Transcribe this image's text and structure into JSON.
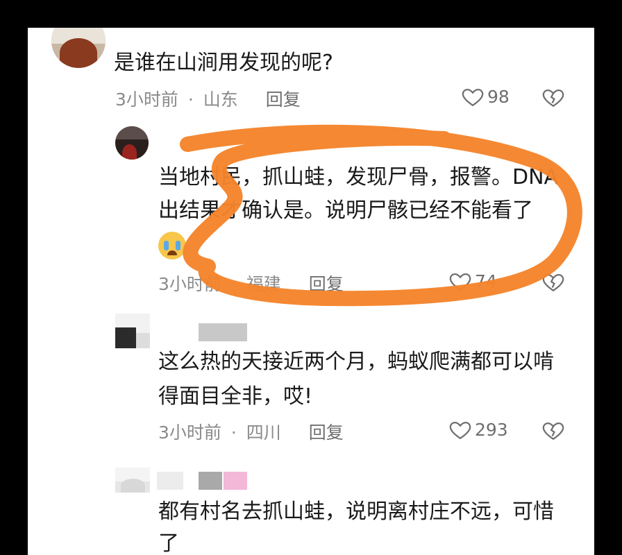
{
  "comments": [
    {
      "text_lines": [
        "是谁在山涧用发现的呢?"
      ],
      "time": "3小时前",
      "location": "山东",
      "separator": "·",
      "reply_label": "回复",
      "likes": "98"
    },
    {
      "text_lines": [
        "当地村民，抓山蛙，发现尸骨，报警。DNA",
        "出结果才确认是。说明尸骸已经不能看了"
      ],
      "emoji": "crying-face",
      "time": "3小时前",
      "location": "福建",
      "separator": "·",
      "reply_label": "回复",
      "likes": "74"
    },
    {
      "text_lines": [
        "这么热的天接近两个月，蚂蚁爬满都可以啃",
        "得面目全非，哎!"
      ],
      "time": "3小时前",
      "location": "四川",
      "separator": "·",
      "reply_label": "回复",
      "likes": "293"
    },
    {
      "text_lines": [
        "都有村名去抓山蛙，说明离村庄不远，可惜",
        "了"
      ]
    }
  ],
  "colors": {
    "highlight_circle": "#f5832a",
    "text": "#1a1a1a",
    "meta": "#8a8a8a"
  },
  "icons": [
    "heart-icon",
    "broken-heart-icon"
  ]
}
